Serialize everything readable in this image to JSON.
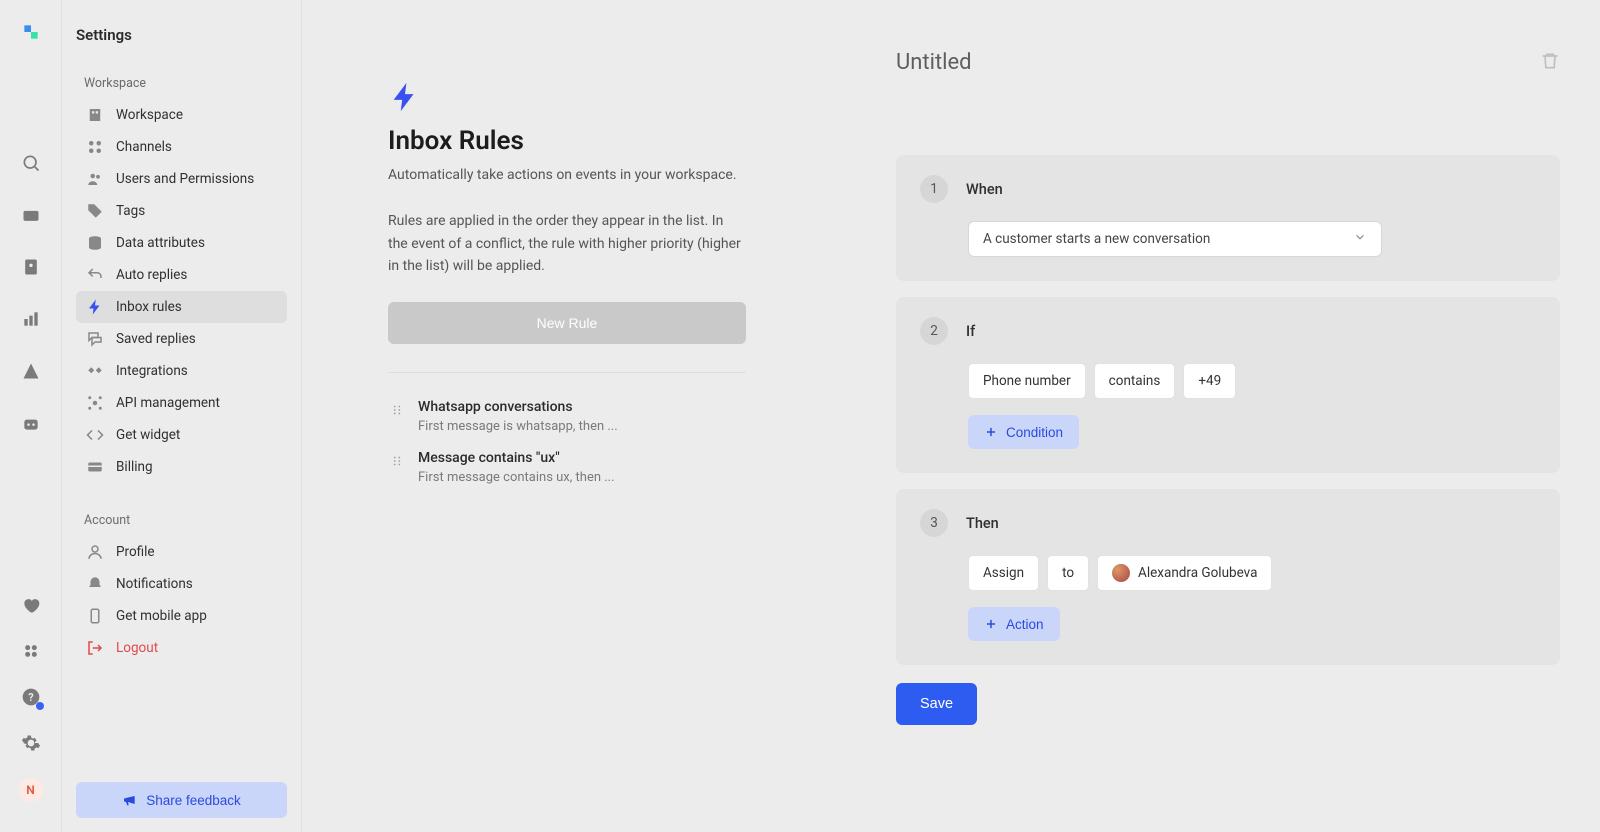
{
  "rail": {
    "user_initial": "N"
  },
  "sidebar": {
    "title": "Settings",
    "sections": {
      "workspace_label": "Workspace",
      "account_label": "Account"
    },
    "items": {
      "workspace": "Workspace",
      "channels": "Channels",
      "users_perms": "Users and Permissions",
      "tags": "Tags",
      "data_attrs": "Data attributes",
      "auto_replies": "Auto replies",
      "inbox_rules": "Inbox rules",
      "saved_replies": "Saved replies",
      "integrations": "Integrations",
      "api_mgmt": "API management",
      "get_widget": "Get widget",
      "billing": "Billing",
      "profile": "Profile",
      "notifications": "Notifications",
      "get_mobile": "Get mobile app",
      "logout": "Logout"
    },
    "share_btn": "Share feedback"
  },
  "list": {
    "title": "Inbox Rules",
    "desc1": "Automatically take actions on events in your workspace.",
    "desc2": "Rules are applied in the order they appear in the list. In the event of a conflict, the rule with higher priority (higher in the list) will be applied.",
    "new_btn": "New Rule",
    "rules": [
      {
        "title": "Whatsapp conversations",
        "sub": "First message is whatsapp, then ..."
      },
      {
        "title": "Message contains \"ux\"",
        "sub": "First message contains ux, then ..."
      }
    ]
  },
  "editor": {
    "title": "Untitled",
    "steps": {
      "when": {
        "num": "1",
        "label": "When",
        "select": "A customer starts a new conversation"
      },
      "if": {
        "num": "2",
        "label": "If",
        "field": "Phone number",
        "op": "contains",
        "val": "+49",
        "add": "Condition"
      },
      "then": {
        "num": "3",
        "label": "Then",
        "act": "Assign",
        "to": "to",
        "assignee": "Alexandra Golubeva",
        "add": "Action"
      }
    },
    "save": "Save"
  }
}
